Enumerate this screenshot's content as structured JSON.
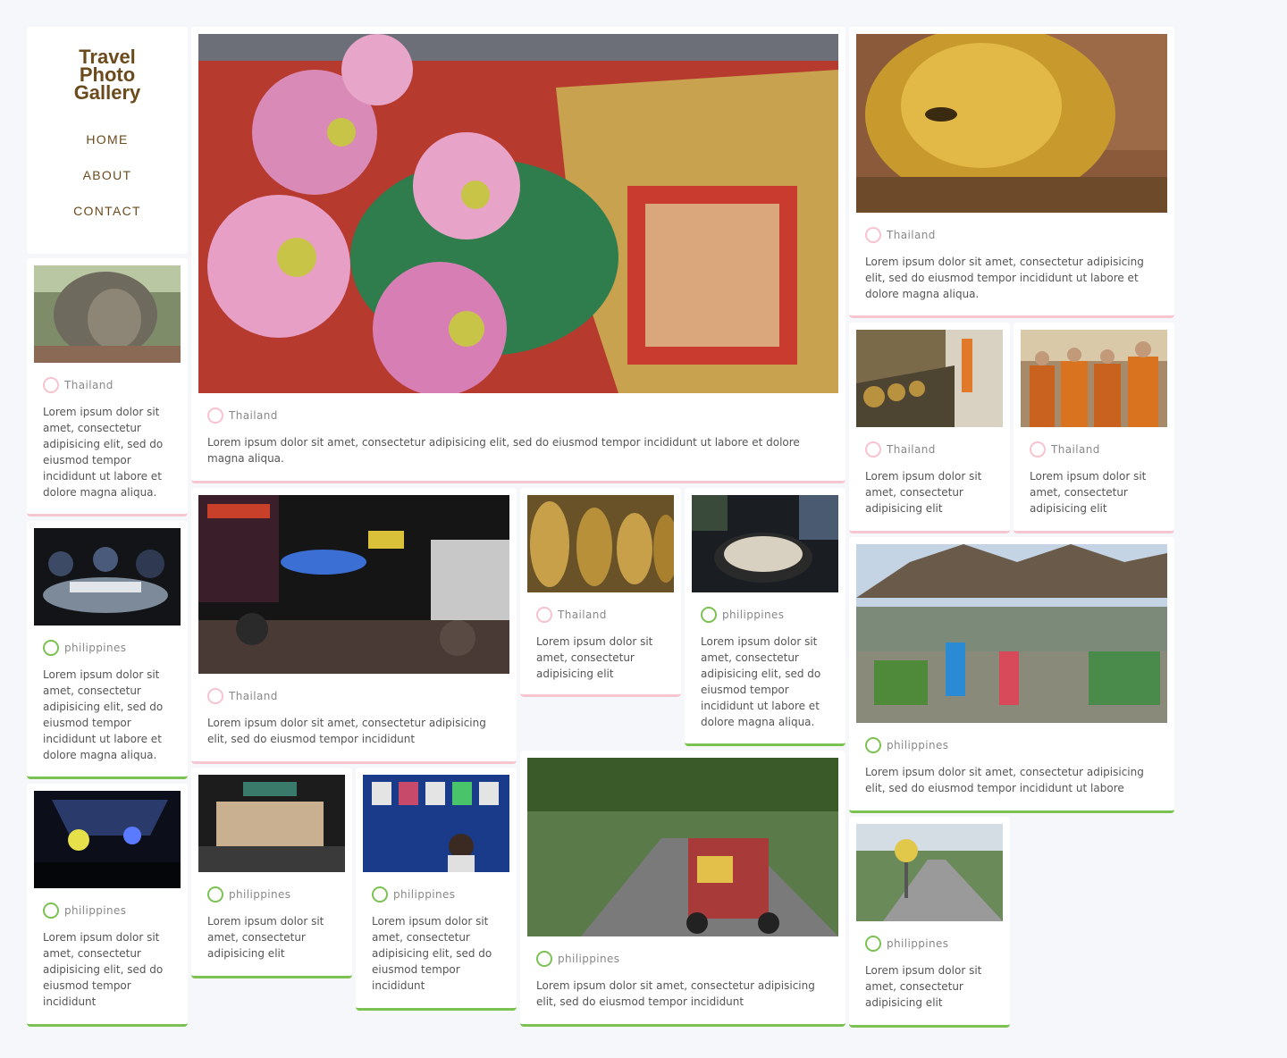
{
  "site": {
    "title_lines": [
      "Travel",
      "Photo",
      "Gallery"
    ],
    "nav": [
      "HOME",
      "ABOUT",
      "CONTACT"
    ]
  },
  "colors": {
    "background": "#f6f7fa",
    "thailand_accent": "#f6c7d1",
    "philippines_accent": "#7cc253",
    "brand_text": "#6b4a1c"
  },
  "cards": [
    {
      "id": "lotus",
      "country": "Thailand",
      "image": "pink lotus flowers and gilded shrine",
      "text": "Lorem ipsum dolor sit amet, consectetur adipisicing elit, sed do eiusmod tempor incididunt ut labore et dolore magna aliqua."
    },
    {
      "id": "buddha-head-tree",
      "country": "Thailand",
      "image": "buddha head in tree roots",
      "text": "Lorem ipsum dolor sit amet, consectetur adipisicing elit, sed do eiusmod tempor incididunt ut labore et dolore magna aliqua."
    },
    {
      "id": "reclining-buddha",
      "country": "Thailand",
      "image": "golden reclining buddha face",
      "text": "Lorem ipsum dolor sit amet, consectetur adipisicing elit, sed do eiusmod tempor incididunt ut labore et dolore magna aliqua."
    },
    {
      "id": "alms-bowls",
      "country": "Thailand",
      "image": "row of alms bowls",
      "text": "Lorem ipsum dolor sit amet, consectetur adipisicing elit"
    },
    {
      "id": "monks",
      "country": "Thailand",
      "image": "monks in orange robes",
      "text": "Lorem ipsum dolor sit amet, consectetur adipisicing elit"
    },
    {
      "id": "night-meal",
      "country": "philippines",
      "image": "people sharing food at night",
      "text": "Lorem ipsum dolor sit amet, consectetur adipisicing elit, sed do eiusmod tempor incididunt ut labore et dolore magna aliqua."
    },
    {
      "id": "khaosan-road",
      "country": "Thailand",
      "image": "neon night street",
      "text": "Lorem ipsum dolor sit amet, consectetur adipisicing elit, sed do eiusmod tempor incididunt"
    },
    {
      "id": "golden-garudas",
      "country": "Thailand",
      "image": "golden temple figures",
      "text": "Lorem ipsum dolor sit amet, consectetur adipisicing elit"
    },
    {
      "id": "street-food",
      "country": "philippines",
      "image": "street food grill",
      "text": "Lorem ipsum dolor sit amet, consectetur adipisicing elit, sed do eiusmod tempor incididunt ut labore et dolore magna aliqua."
    },
    {
      "id": "market",
      "country": "philippines",
      "image": "outdoor produce market",
      "text": "Lorem ipsum dolor sit amet, consectetur adipisicing elit, sed do eiusmod tempor incididunt ut labore"
    },
    {
      "id": "concert",
      "country": "philippines",
      "image": "concert stage lights",
      "text": "Lorem ipsum dolor sit amet, consectetur adipisicing elit, sed do eiusmod tempor incididunt"
    },
    {
      "id": "smart-store",
      "country": "philippines",
      "image": "shop front at night",
      "text": "Lorem ipsum dolor sit amet, consectetur adipisicing elit"
    },
    {
      "id": "tshirt-stall",
      "country": "philippines",
      "image": "t-shirt stall at night",
      "text": "Lorem ipsum dolor sit amet, consectetur adipisicing elit, sed do eiusmod tempor incididunt"
    },
    {
      "id": "tricycle",
      "country": "philippines",
      "image": "tricycle on tree-lined road",
      "text": "Lorem ipsum dolor sit amet, consectetur adipisicing elit, sed do eiusmod tempor incididunt"
    },
    {
      "id": "speed-sign",
      "country": "philippines",
      "image": "road with speed sign",
      "text": "Lorem ipsum dolor sit amet, consectetur adipisicing elit"
    }
  ]
}
